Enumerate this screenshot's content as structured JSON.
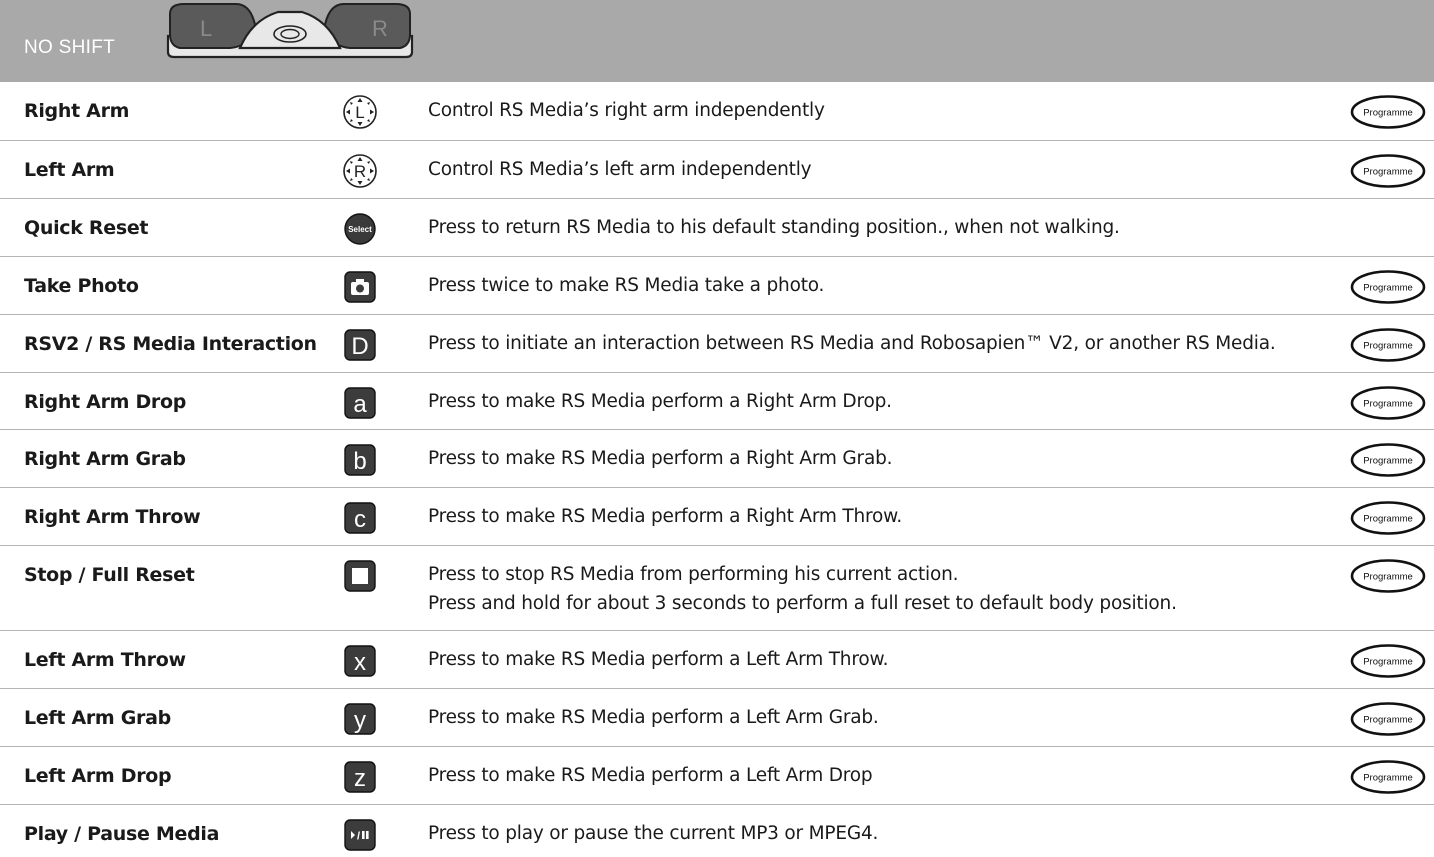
{
  "header": {
    "title": "NO SHIFT",
    "controller": {
      "left_label": "L",
      "right_label": "R"
    }
  },
  "programme_label": "Programme",
  "rows": [
    {
      "name": "Right Arm",
      "icon": "L",
      "icon_name": "left-joystick-icon",
      "description": [
        "Control RS Media’s right arm independently"
      ],
      "programme": true
    },
    {
      "name": "Left Arm",
      "icon": "R",
      "icon_name": "right-joystick-icon",
      "description": [
        "Control RS Media’s left arm independently"
      ],
      "programme": true
    },
    {
      "name": "Quick Reset",
      "icon": "Select",
      "icon_name": "select-button-icon",
      "description": [
        "Press to return RS Media to his default standing position., when not walking."
      ],
      "programme": false
    },
    {
      "name": "Take Photo",
      "icon": "camera",
      "icon_name": "camera-button-icon",
      "description": [
        "Press twice to make RS Media take a photo."
      ],
      "programme": true
    },
    {
      "name": "RSV2 / RS Media Interaction",
      "icon": "D",
      "icon_name": "d-button-icon",
      "description": [
        "Press to initiate an interaction between RS Media and Robosapien™ V2, or another RS Media."
      ],
      "programme": true
    },
    {
      "name": "Right Arm Drop",
      "icon": "a",
      "icon_name": "a-button-icon",
      "description": [
        "Press to make RS Media perform a Right Arm Drop."
      ],
      "programme": true
    },
    {
      "name": "Right Arm Grab",
      "icon": "b",
      "icon_name": "b-button-icon",
      "description": [
        "Press to make RS Media perform a Right Arm Grab."
      ],
      "programme": true
    },
    {
      "name": "Right Arm Throw",
      "icon": "c",
      "icon_name": "c-button-icon",
      "description": [
        "Press to make RS Media perform a Right Arm Throw."
      ],
      "programme": true
    },
    {
      "name": "Stop / Full Reset",
      "icon": "stop",
      "icon_name": "stop-button-icon",
      "description": [
        "Press to stop RS Media from performing his current action.",
        "Press and hold for about 3 seconds to perform a full reset to default body position."
      ],
      "programme": true
    },
    {
      "name": "Left Arm Throw",
      "icon": "x",
      "icon_name": "x-button-icon",
      "description": [
        "Press to make RS Media perform a  Left Arm Throw."
      ],
      "programme": true
    },
    {
      "name": "Left Arm Grab",
      "icon": "y",
      "icon_name": "y-button-icon",
      "description": [
        "Press to make RS Media perform a Left Arm Grab."
      ],
      "programme": true
    },
    {
      "name": "Left Arm Drop",
      "icon": "z",
      "icon_name": "z-button-icon",
      "description": [
        "Press to make RS Media perform a  Left Arm Drop"
      ],
      "programme": true
    },
    {
      "name": "Play / Pause Media",
      "icon": "▸/II",
      "icon_name": "play-pause-button-icon",
      "description": [
        "Press to play or pause the current MP3 or MPEG4."
      ],
      "programme": false
    }
  ]
}
